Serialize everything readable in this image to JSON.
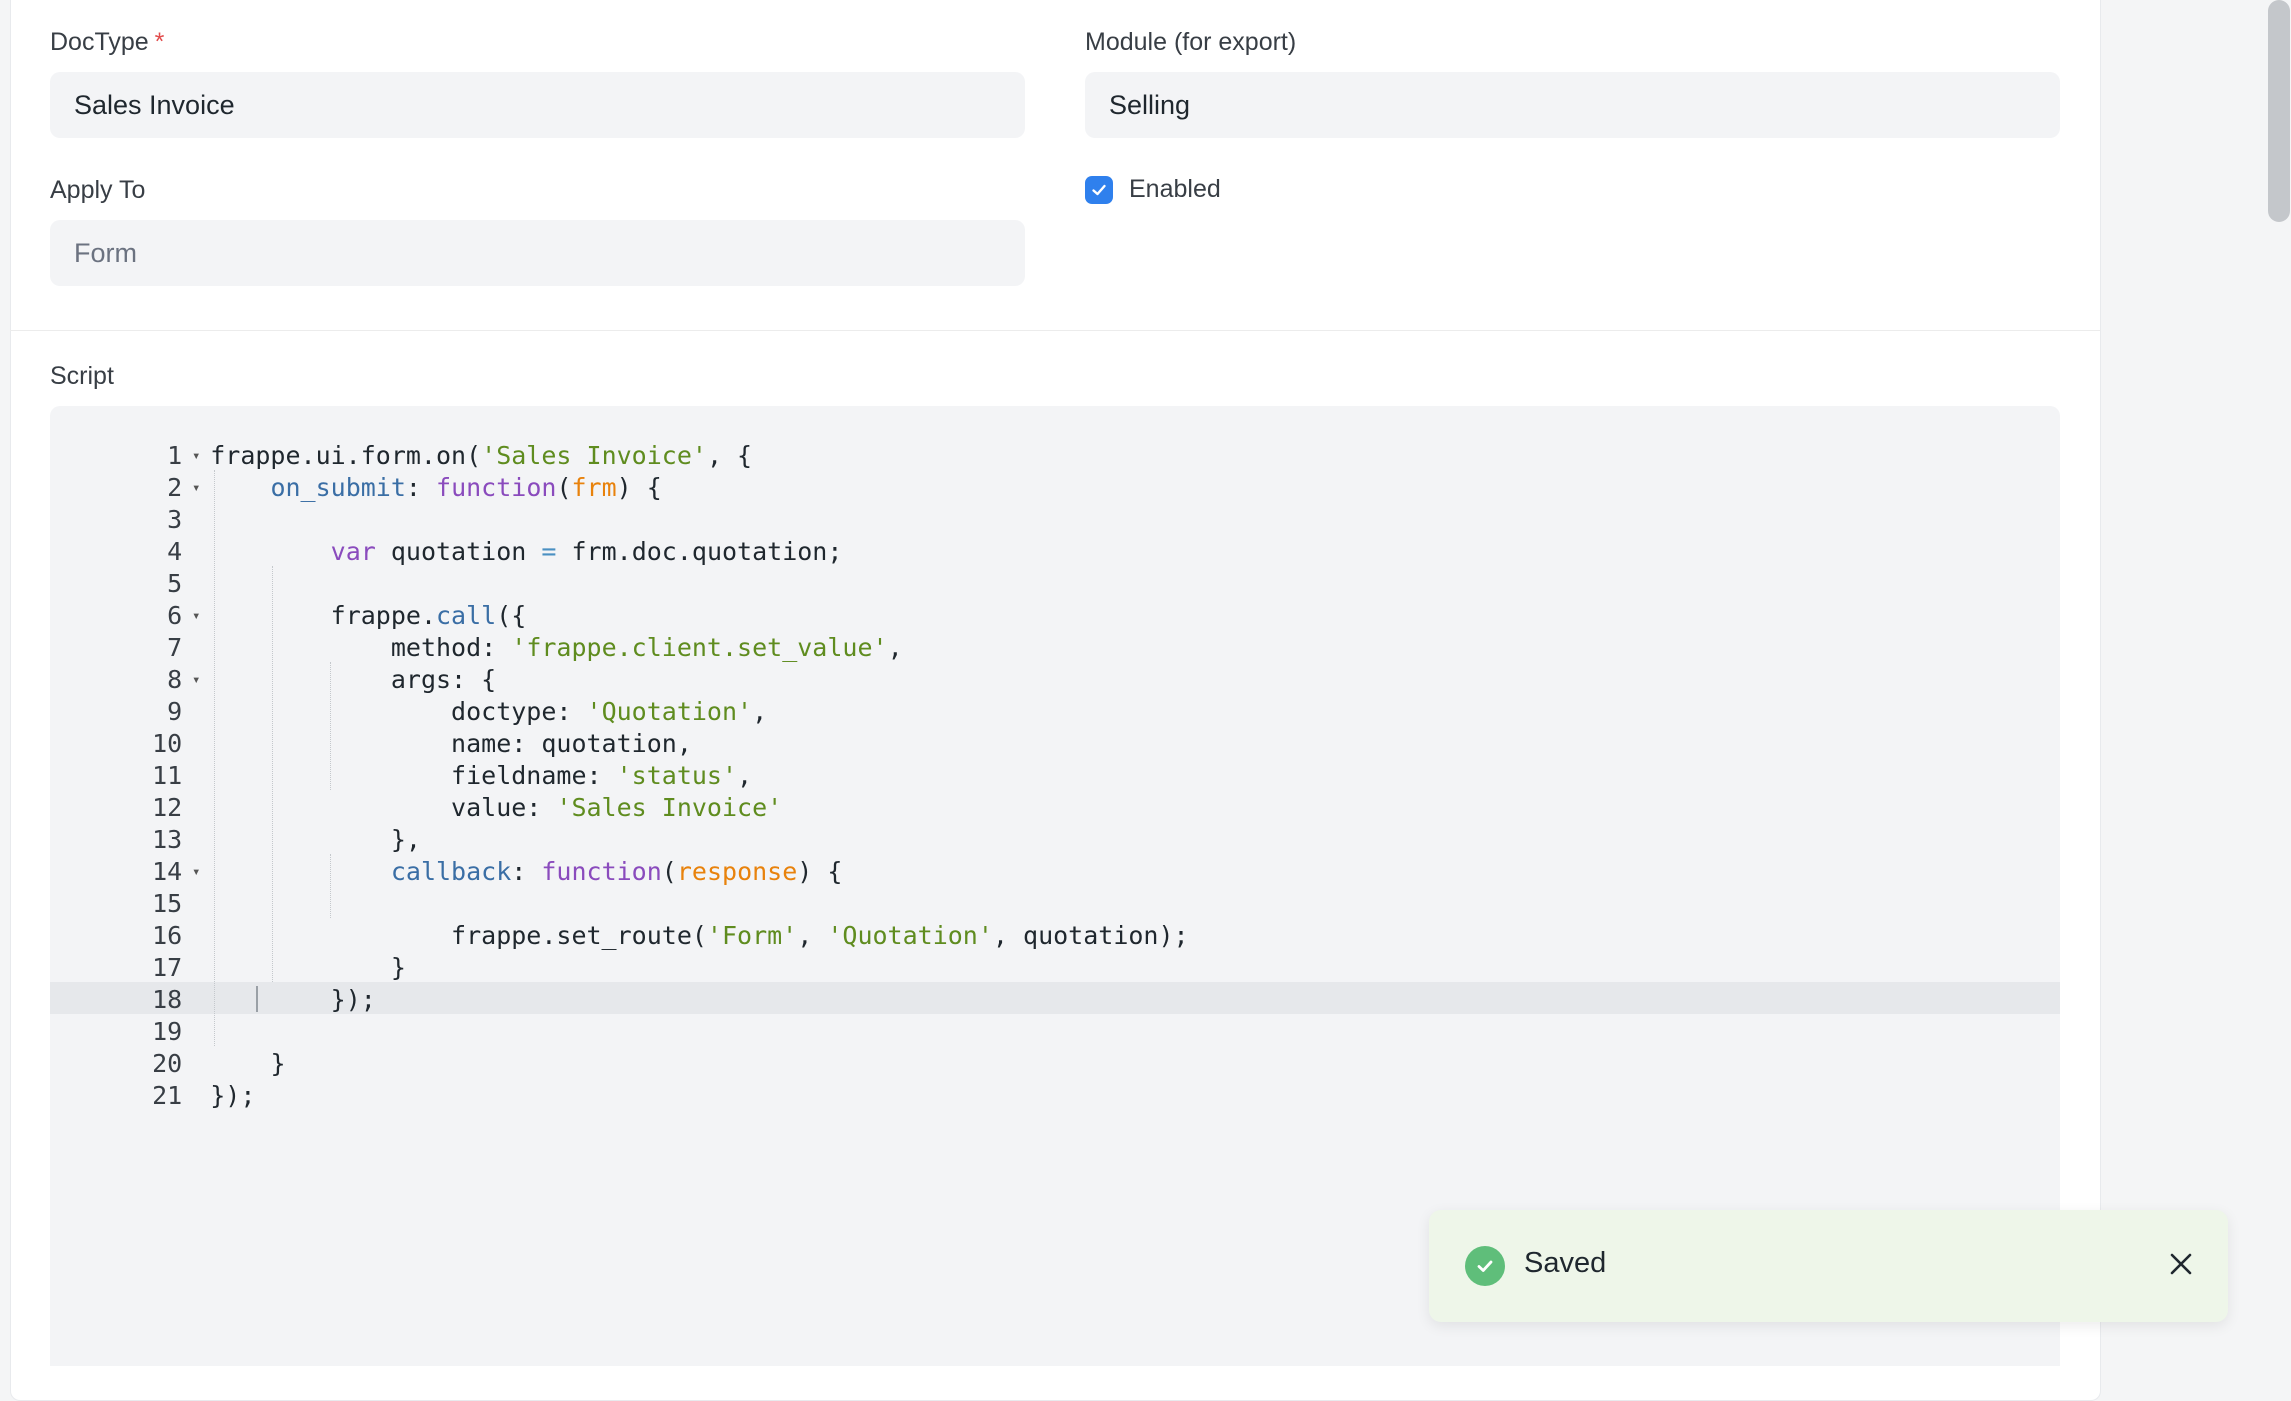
{
  "form": {
    "doctype_label": "DocType",
    "doctype_required": "*",
    "doctype_value": "Sales Invoice",
    "module_label": "Module (for export)",
    "module_value": "Selling",
    "apply_to_label": "Apply To",
    "apply_to_value": "Form",
    "enabled_label": "Enabled",
    "enabled_checked": true,
    "script_label": "Script"
  },
  "editor": {
    "active_line": 19,
    "lines": [
      {
        "n": "1",
        "fold": true
      },
      {
        "n": "2",
        "fold": true
      },
      {
        "n": "3",
        "fold": false
      },
      {
        "n": "4",
        "fold": false
      },
      {
        "n": "5",
        "fold": false
      },
      {
        "n": "6",
        "fold": true
      },
      {
        "n": "7",
        "fold": false
      },
      {
        "n": "8",
        "fold": true
      },
      {
        "n": "9",
        "fold": false
      },
      {
        "n": "10",
        "fold": false
      },
      {
        "n": "11",
        "fold": false
      },
      {
        "n": "12",
        "fold": false
      },
      {
        "n": "13",
        "fold": false
      },
      {
        "n": "14",
        "fold": true
      },
      {
        "n": "15",
        "fold": false
      },
      {
        "n": "16",
        "fold": false
      },
      {
        "n": "17",
        "fold": false
      },
      {
        "n": "18",
        "fold": false
      },
      {
        "n": "19",
        "fold": false
      },
      {
        "n": "20",
        "fold": false
      },
      {
        "n": "21",
        "fold": false
      }
    ],
    "tokens": {
      "l1_a": "frappe.ui.form.on(",
      "l1_b": "'Sales Invoice'",
      "l1_c": ", {",
      "l2_a": "on_submit",
      "l2_b": ": ",
      "l2_c": "function",
      "l2_d": "(",
      "l2_e": "frm",
      "l2_f": ") {",
      "l4_a": "var",
      "l4_b": " quotation ",
      "l4_c": "=",
      "l4_d": " frm.doc.quotation;",
      "l6_a": "frappe.",
      "l6_b": "call",
      "l6_c": "({",
      "l7_a": "method: ",
      "l7_b": "'frappe.client.set_value'",
      "l7_c": ",",
      "l8_a": "args: {",
      "l9_a": "doctype: ",
      "l9_b": "'Quotation'",
      "l9_c": ",",
      "l10_a": "name: quotation,",
      "l11_a": "fieldname: ",
      "l11_b": "'status'",
      "l11_c": ",",
      "l12_a": "value: ",
      "l12_b": "'Sales Invoice'",
      "l13_a": "},",
      "l14_a": "callback",
      "l14_b": ": ",
      "l14_c": "function",
      "l14_d": "(",
      "l14_e": "response",
      "l14_f": ") {",
      "l16_a": "frappe.set_route(",
      "l16_b": "'Form'",
      "l16_c": ", ",
      "l16_d": "'Quotation'",
      "l16_e": ", quotation);",
      "l17_a": "}",
      "l18_a": "});",
      "l20_a": "}",
      "l21_a": "});"
    }
  },
  "toast": {
    "message": "Saved",
    "icon": "check-circle-icon",
    "close_icon": "close-icon"
  },
  "colors": {
    "accent": "#2f80ed",
    "success": "#5fbe7a",
    "toast_bg": "#eef6e9"
  }
}
